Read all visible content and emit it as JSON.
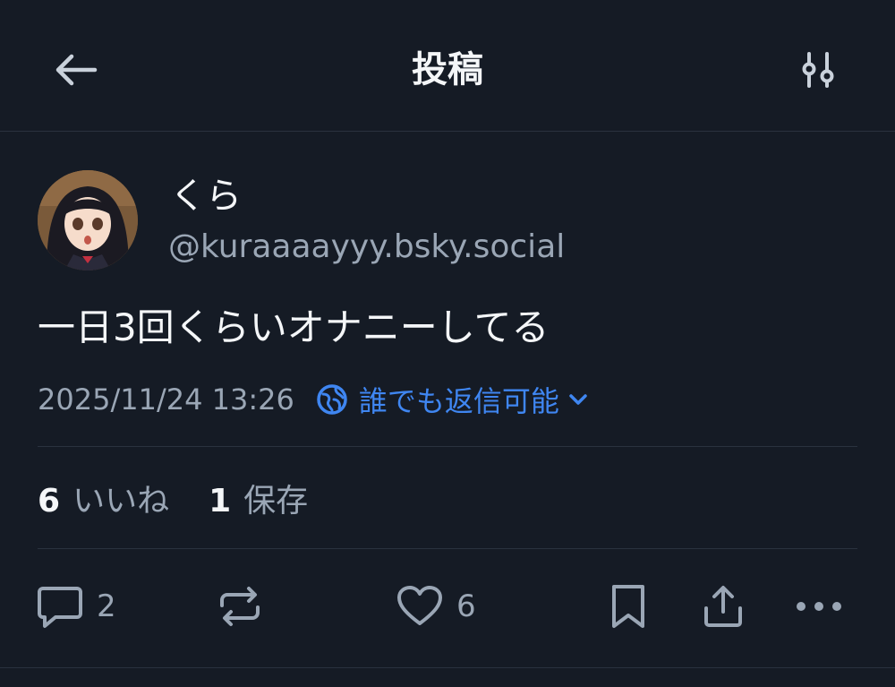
{
  "header": {
    "title": "投稿",
    "back_icon": "arrow-left-icon",
    "settings_icon": "sliders-icon"
  },
  "post": {
    "display_name": "くら",
    "handle": "@kuraaaayyy.bsky.social",
    "text": "一日3回くらいオナニーしてる",
    "timestamp": "2025/11/24 13:26",
    "reply_setting": "誰でも返信可能"
  },
  "stats": {
    "likes_count": "6",
    "likes_label": "いいね",
    "saves_count": "1",
    "saves_label": "保存"
  },
  "actions": {
    "reply_count": "2",
    "like_count": "6"
  },
  "colors": {
    "background": "#151b25",
    "accent": "#3f86f1",
    "muted": "#9aa6b5",
    "divider": "#2a323e"
  }
}
